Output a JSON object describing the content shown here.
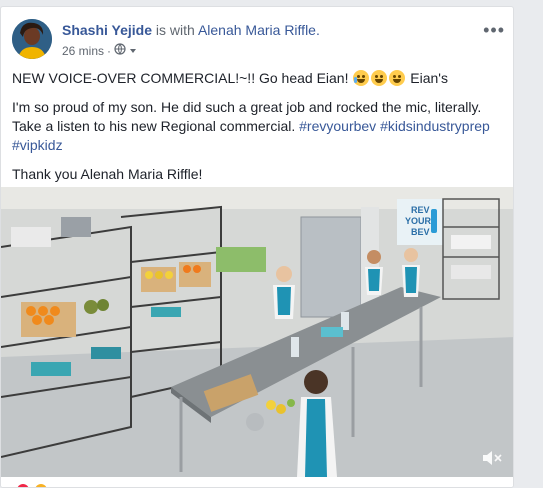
{
  "post": {
    "author": "Shashi Yejide",
    "with_text": "is with",
    "tagged": "Alenah Maria Riffle.",
    "time": "26 mins",
    "separator": "·",
    "more_label": "•••",
    "line1": "NEW VOICE-OVER COMMERCIAL!~!! Go head Eian!",
    "line1_after": "Eian's",
    "line2": "I'm so proud of my son. He did such a great job and rocked the mic, literally. Take a listen to his new Regional commercial.",
    "hashtags": [
      "#revyourbev",
      "#kidsindustryprep",
      "#vipkidz"
    ],
    "line3": "Thank you Alenah Maria Riffle!"
  },
  "video": {
    "sign_text": [
      "REV",
      "YOUR",
      "BEV"
    ]
  },
  "colors": {
    "link": "#385898",
    "text": "#1d2129",
    "meta": "#606770",
    "background": "#e9ebee"
  }
}
